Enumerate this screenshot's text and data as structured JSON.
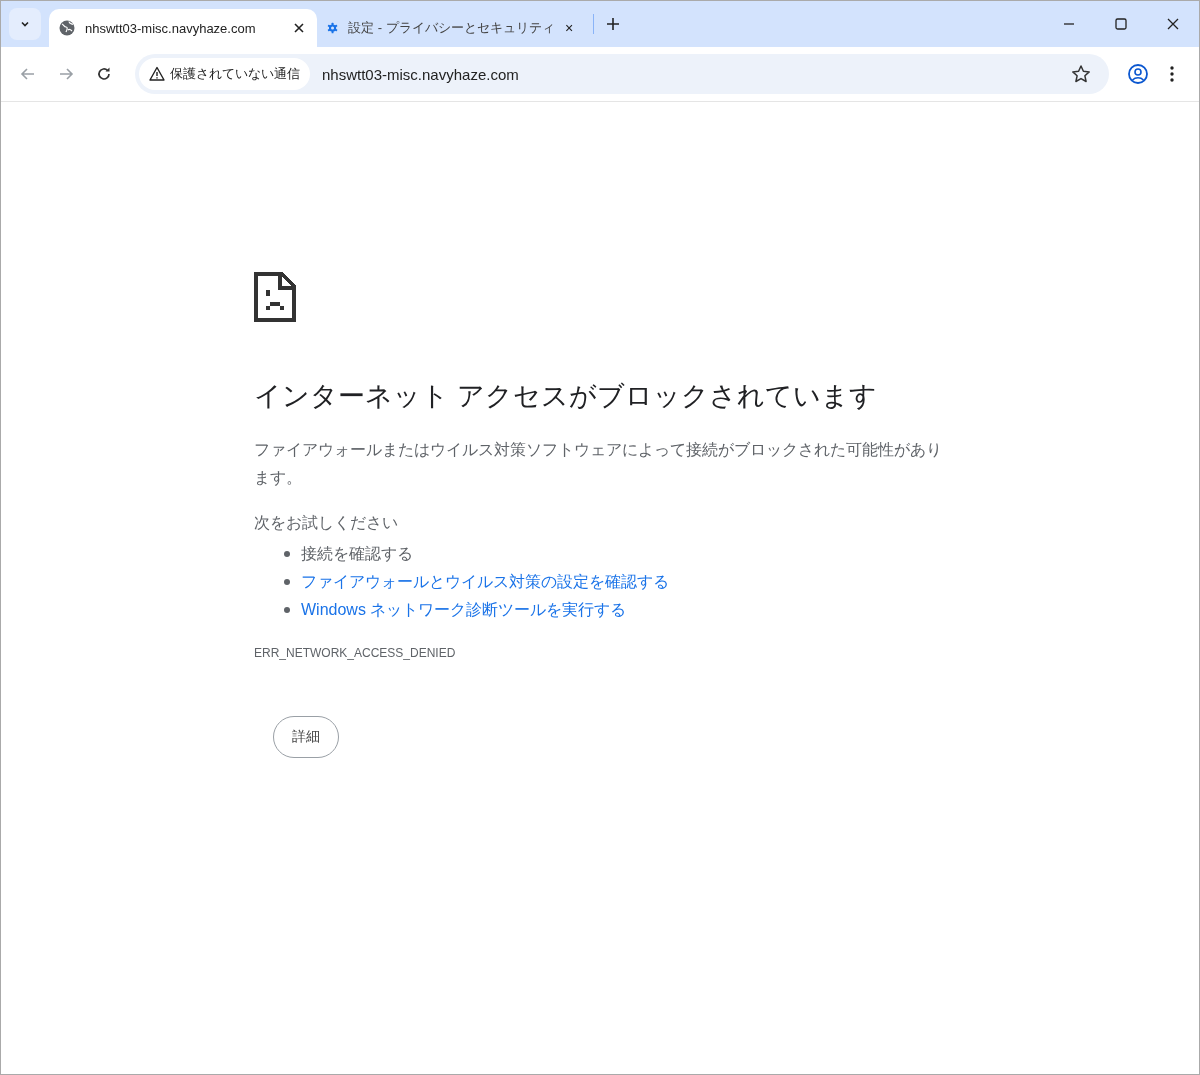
{
  "tabs": [
    {
      "title": "nhswtt03-misc.navyhaze.com",
      "kind": "web_page",
      "selected": true
    },
    {
      "title": "設定 - プライバシーとセキュリティ",
      "kind": "settings",
      "selected": false
    }
  ],
  "address_bar": {
    "security_label": "保護されていない通信",
    "url": "nhswtt03-misc.navyhaze.com"
  },
  "error_page": {
    "heading": "インターネット アクセスがブロックされています",
    "description": "ファイアウォールまたはウイルス対策ソフトウェアによって接続がブロックされた可能性があります。",
    "suggestions_heading": "次をお試しください",
    "suggestions": [
      {
        "kind": "text",
        "text": "接続を確認する"
      },
      {
        "kind": "link",
        "text": "ファイアウォールとウイルス対策の設定を確認する"
      },
      {
        "kind": "link",
        "text": "Windows ネットワーク診断ツールを実行する"
      }
    ],
    "error_code": "ERR_NETWORK_ACCESS_DENIED",
    "details_button": "詳細"
  }
}
